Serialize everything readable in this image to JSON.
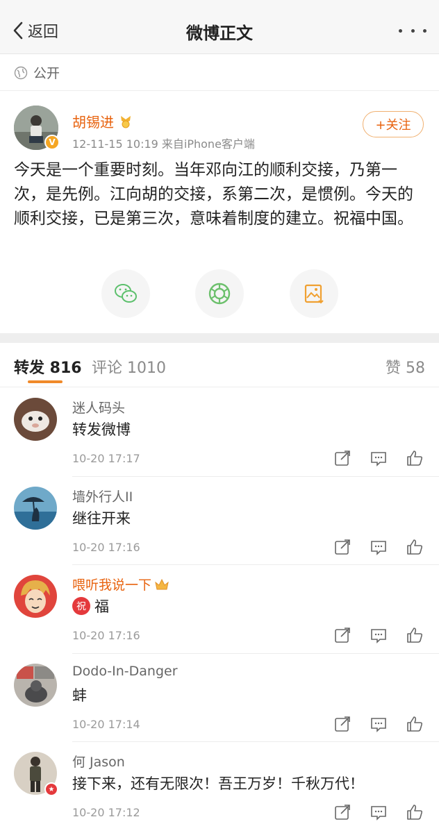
{
  "nav": {
    "back_label": "返回",
    "title": "微博正文"
  },
  "visibility": {
    "label": "公开",
    "icon": "globe-icon"
  },
  "post": {
    "author": "胡锡进",
    "meta": "12-11-15 10:19  来自iPhone客户端",
    "follow_label": "+关注",
    "text": "今天是一个重要时刻。当年邓向江的顺利交接，乃第一次，是先例。江向胡的交接，系第二次，是惯例。今天的顺利交接，已是第三次，意味着制度的建立。祝福中国。",
    "share_icons": [
      "wechat-icon",
      "moments-icon",
      "save-image-icon"
    ]
  },
  "tabs": {
    "repost": "转发 816",
    "comment": "评论 1010",
    "like": "赞 58"
  },
  "reposts": [
    {
      "user": "迷人码头",
      "text": "转发微博",
      "time": "10-20 17:17"
    },
    {
      "user": "墙外行人II",
      "text": "继往开来",
      "time": "10-20 17:16"
    },
    {
      "user": "喂听我说一下",
      "badge": "祝",
      "text": "福",
      "time": "10-20 17:16"
    },
    {
      "user": "Dodo-In-Danger",
      "text": "蚌",
      "time": "10-20 17:14"
    },
    {
      "user": "何 Jason",
      "text": "接下来，还有无限次！吾王万岁！千秋万代！",
      "time": "10-20 17:12"
    }
  ],
  "colors": {
    "accent": "#e8630f",
    "tab_underline": "#f08a2a",
    "gap": "#eeeeee"
  }
}
